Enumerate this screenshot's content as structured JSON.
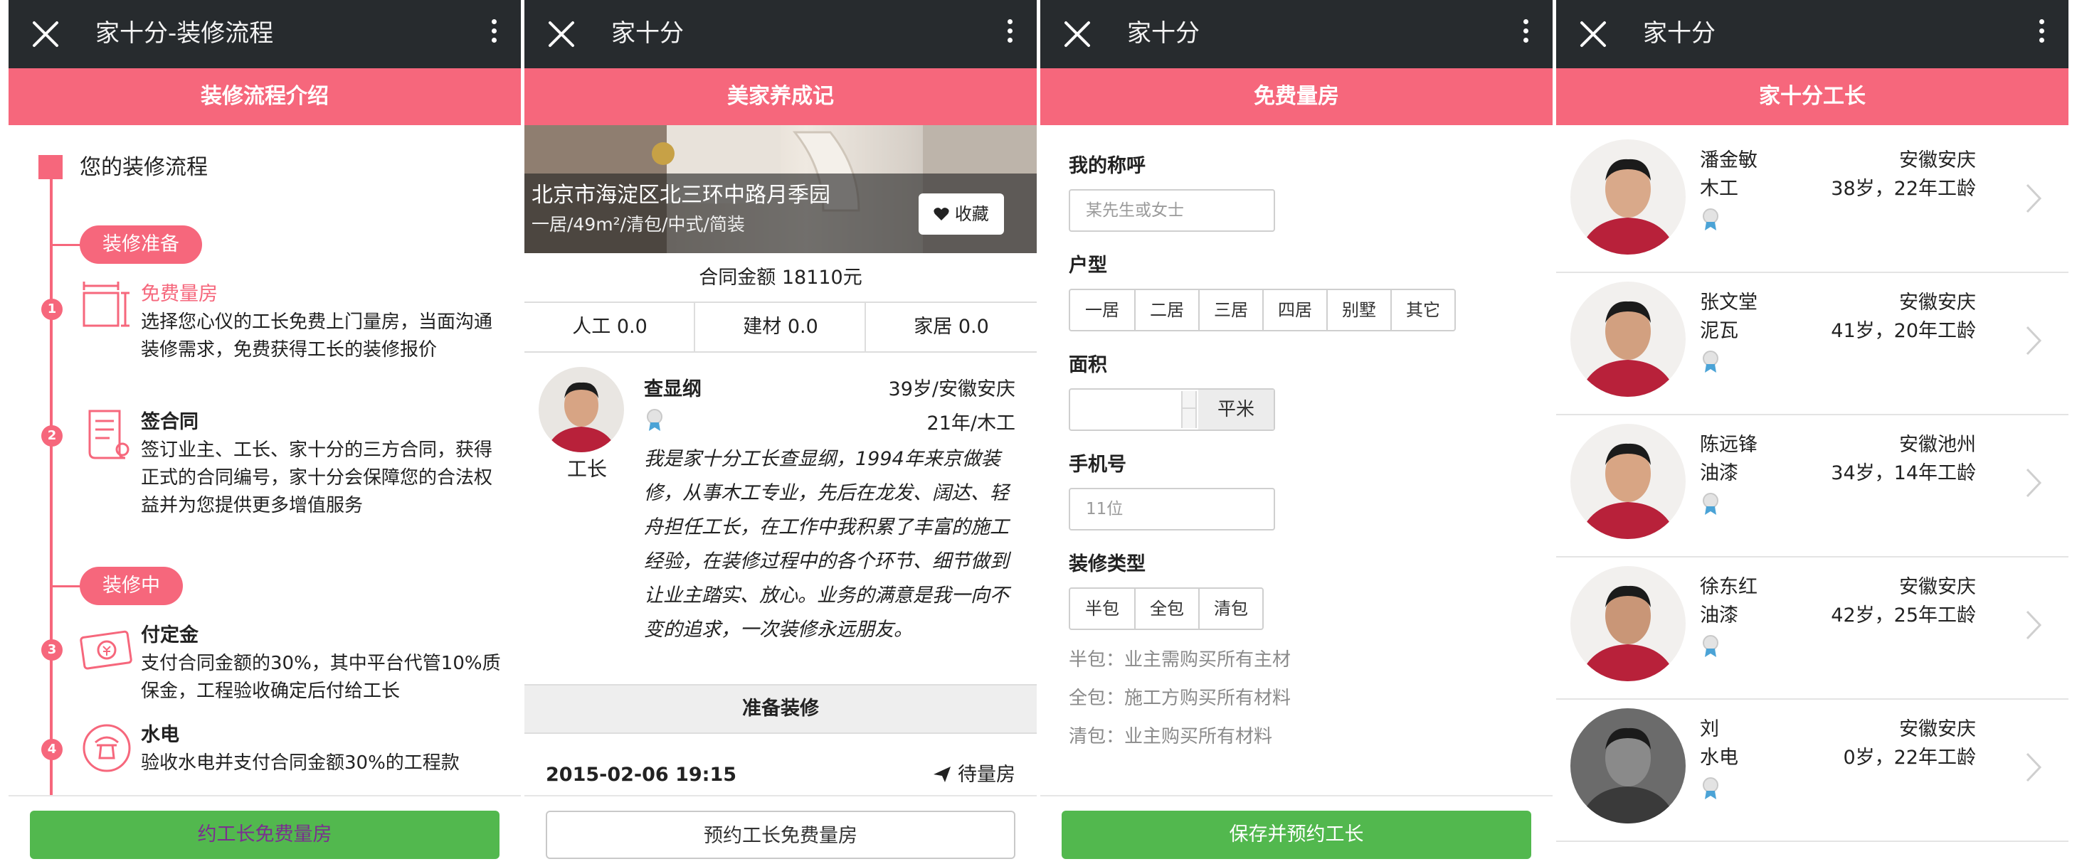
{
  "panels": [
    {
      "title": "家十分-装修流程",
      "banner": "装修流程介绍",
      "timeline_heading": "您的装修流程",
      "stages": [
        "装修准备",
        "装修中"
      ],
      "steps": [
        {
          "num": "1",
          "icon": "measure-icon",
          "title": "免费量房",
          "body": "选择您心仪的工长免费上门量房，当面沟通装修需求，免费获得工长的装修报价"
        },
        {
          "num": "2",
          "icon": "contract-scroll-icon",
          "title": "签合同",
          "body": "签订业主、工长、家十分的三方合同，获得正式的合同编号，家十分会保障您的合法权益并为您提供更多增值服务"
        },
        {
          "num": "3",
          "icon": "money-icon",
          "title": "付定金",
          "body": "支付合同金额的30%，其中平台代管10%质保金，工程验收确定后付给工长"
        },
        {
          "num": "4",
          "icon": "plumbing-icon",
          "title": "水电",
          "body": "验收水电并支付合同金额30%的工程款"
        }
      ],
      "button": "约工长免费量房"
    },
    {
      "title": "家十分",
      "banner": "美家养成记",
      "address": "北京市海淀区北三环中路月季园",
      "meta": "一居/49m²/清包/中式/简装",
      "fav_label": "收藏",
      "contract_amount": "合同金额 18110元",
      "costs": [
        "人工 0.0",
        "建材 0.0",
        "家居 0.0"
      ],
      "role": "工长",
      "worker_name": "查显纲",
      "worker_age_loc": "39岁/安徽安庆",
      "worker_exp_trade": "21年/木工",
      "bio": "我是家十分工长查显纲，1994年来京做装修，从事木工专业，先后在龙发、阔达、轻舟担任工长，在工作中我积累了丰富的施工经验，在装修过程中的各个环节、细节做到让业主踏实、放心。业务的满意是我一向不变的追求，一次装修永远朋友。",
      "stage_bar": "准备装修",
      "date": "2015-02-06 19:15",
      "status": "待量房",
      "button": "预约工长免费量房"
    },
    {
      "title": "家十分",
      "banner": "免费量房",
      "name_label": "我的称呼",
      "name_placeholder": "某先生或女士",
      "layout_label": "户型",
      "layout_options": [
        "一居",
        "二居",
        "三居",
        "四居",
        "别墅",
        "其它"
      ],
      "area_label": "面积",
      "area_unit": "平米",
      "phone_label": "手机号",
      "phone_placeholder": "11位",
      "type_label": "装修类型",
      "type_options": [
        "半包",
        "全包",
        "清包"
      ],
      "notes": [
        "半包：业主需购买所有主材",
        "全包：施工方购买所有材料",
        "清包：业主购买所有材料"
      ],
      "button": "保存并预约工长"
    },
    {
      "title": "家十分",
      "banner": "家十分工长",
      "workers": [
        {
          "name": "潘金敏",
          "trade": "木工",
          "loc": "安徽安庆",
          "exp": "38岁，22年工龄"
        },
        {
          "name": "张文堂",
          "trade": "泥瓦",
          "loc": "安徽安庆",
          "exp": "41岁，20年工龄"
        },
        {
          "name": "陈远锋",
          "trade": "油漆",
          "loc": "安徽池州",
          "exp": "34岁，14年工龄"
        },
        {
          "name": "徐东红",
          "trade": "油漆",
          "loc": "安徽安庆",
          "exp": "42岁，25年工龄"
        },
        {
          "name": "刘",
          "trade": "水电",
          "loc": "安徽安庆",
          "exp": "0岁，22年工龄"
        }
      ]
    }
  ],
  "colors": {
    "accent": "#f6677c",
    "titlebar": "#272b2e",
    "green": "#52b84e"
  }
}
